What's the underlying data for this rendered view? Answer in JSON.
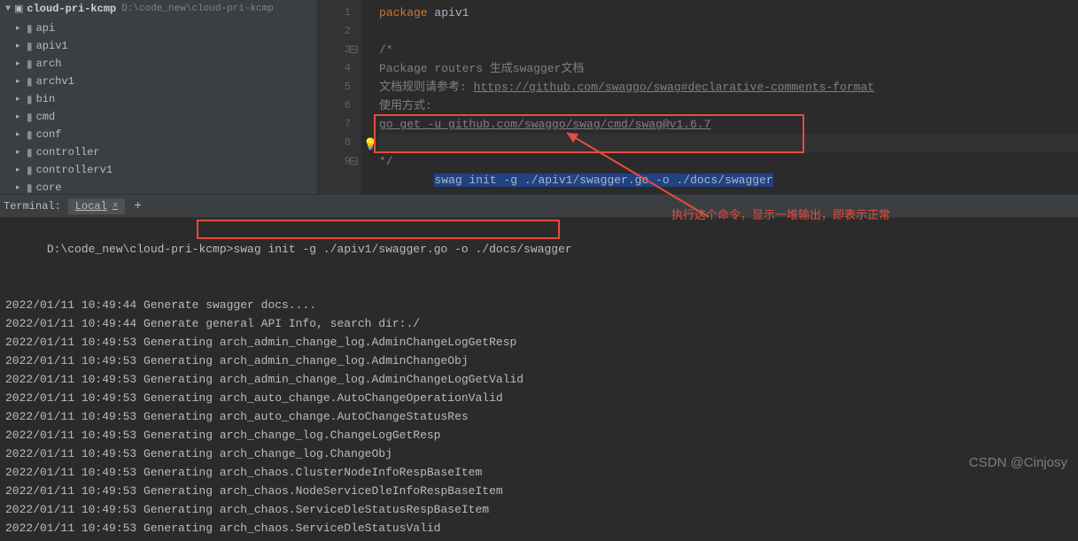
{
  "project": {
    "name": "cloud-pri-kcmp",
    "path": "D:\\code_new\\cloud-pri-kcmp",
    "folders": [
      "api",
      "apiv1",
      "arch",
      "archv1",
      "bin",
      "cmd",
      "conf",
      "controller",
      "controllerv1",
      "core"
    ]
  },
  "editor": {
    "line_numbers": [
      "1",
      "2",
      "3",
      "4",
      "5",
      "6",
      "7",
      "8",
      "9"
    ],
    "pkg_keyword": "package",
    "pkg_name": "apiv1",
    "comment_open": "/*",
    "comment_l4": "Package routers 生成swagger文档",
    "comment_l5_prefix": "文档规则请参考: ",
    "comment_l5_link": "https://github.com/swaggo/swag#declarative-comments-format",
    "comment_l6": "使用方式:",
    "comment_l7": "go get -u github.com/swaggo/swag/cmd/swag@v1.6.7",
    "comment_l8": "swag init -g ./apiv1/swagger.go -o ./docs/swagger",
    "comment_close": "*/"
  },
  "terminal": {
    "panel_label": "Terminal:",
    "tab_name": "Local",
    "prompt": "D:\\code_new\\cloud-pri-kcmp>",
    "command": "swag init -g ./apiv1/swagger.go -o ./docs/swagger",
    "output": [
      "2022/01/11 10:49:44 Generate swagger docs....",
      "2022/01/11 10:49:44 Generate general API Info, search dir:./",
      "2022/01/11 10:49:53 Generating arch_admin_change_log.AdminChangeLogGetResp",
      "2022/01/11 10:49:53 Generating arch_admin_change_log.AdminChangeObj",
      "2022/01/11 10:49:53 Generating arch_admin_change_log.AdminChangeLogGetValid",
      "2022/01/11 10:49:53 Generating arch_auto_change.AutoChangeOperationValid",
      "2022/01/11 10:49:53 Generating arch_auto_change.AutoChangeStatusRes",
      "2022/01/11 10:49:53 Generating arch_change_log.ChangeLogGetResp",
      "2022/01/11 10:49:53 Generating arch_change_log.ChangeObj",
      "2022/01/11 10:49:53 Generating arch_chaos.ClusterNodeInfoRespBaseItem",
      "2022/01/11 10:49:53 Generating arch_chaos.NodeServiceDleInfoRespBaseItem",
      "2022/01/11 10:49:53 Generating arch_chaos.ServiceDleStatusRespBaseItem",
      "2022/01/11 10:49:53 Generating arch_chaos.ServiceDleStatusValid"
    ]
  },
  "annotation": {
    "text": "执行这个命令，显示一堆输出，即表示正常"
  },
  "watermark": "CSDN @Cinjosy"
}
